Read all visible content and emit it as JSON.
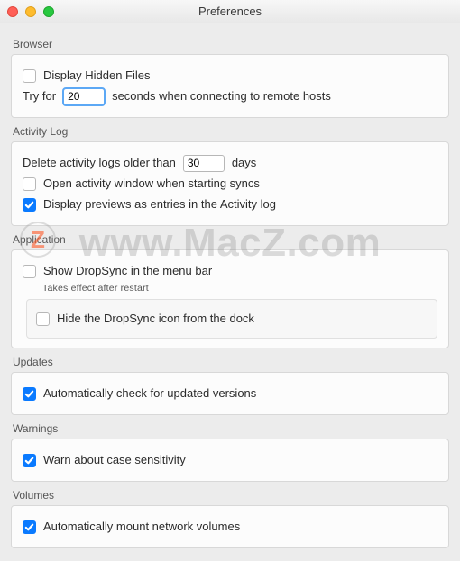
{
  "window": {
    "title": "Preferences"
  },
  "sections": {
    "browser": {
      "label": "Browser",
      "hidden_files": {
        "label": "Display Hidden Files",
        "checked": false
      },
      "try_for_prefix": "Try for",
      "try_for_value": "20",
      "try_for_suffix": "seconds when connecting to remote hosts"
    },
    "activity": {
      "label": "Activity Log",
      "older_prefix": "Delete activity logs older than",
      "older_value": "30",
      "older_suffix": "days",
      "open_window": {
        "label": "Open activity window when starting syncs",
        "checked": false
      },
      "previews": {
        "label": "Display previews as entries in the Activity log",
        "checked": true
      }
    },
    "application": {
      "label": "Application",
      "menubar": {
        "label": "Show DropSync in the menu bar",
        "checked": false
      },
      "menubar_note": "Takes effect after restart",
      "hide_dock": {
        "label": "Hide the DropSync icon from the dock",
        "checked": false
      }
    },
    "updates": {
      "label": "Updates",
      "auto": {
        "label": "Automatically check for updated versions",
        "checked": true
      }
    },
    "warnings": {
      "label": "Warnings",
      "case": {
        "label": "Warn about case sensitivity",
        "checked": true
      }
    },
    "volumes": {
      "label": "Volumes",
      "mount": {
        "label": "Automatically mount network volumes",
        "checked": true
      }
    }
  },
  "watermark": {
    "badge": "Z",
    "text": "www.MacZ.com"
  }
}
